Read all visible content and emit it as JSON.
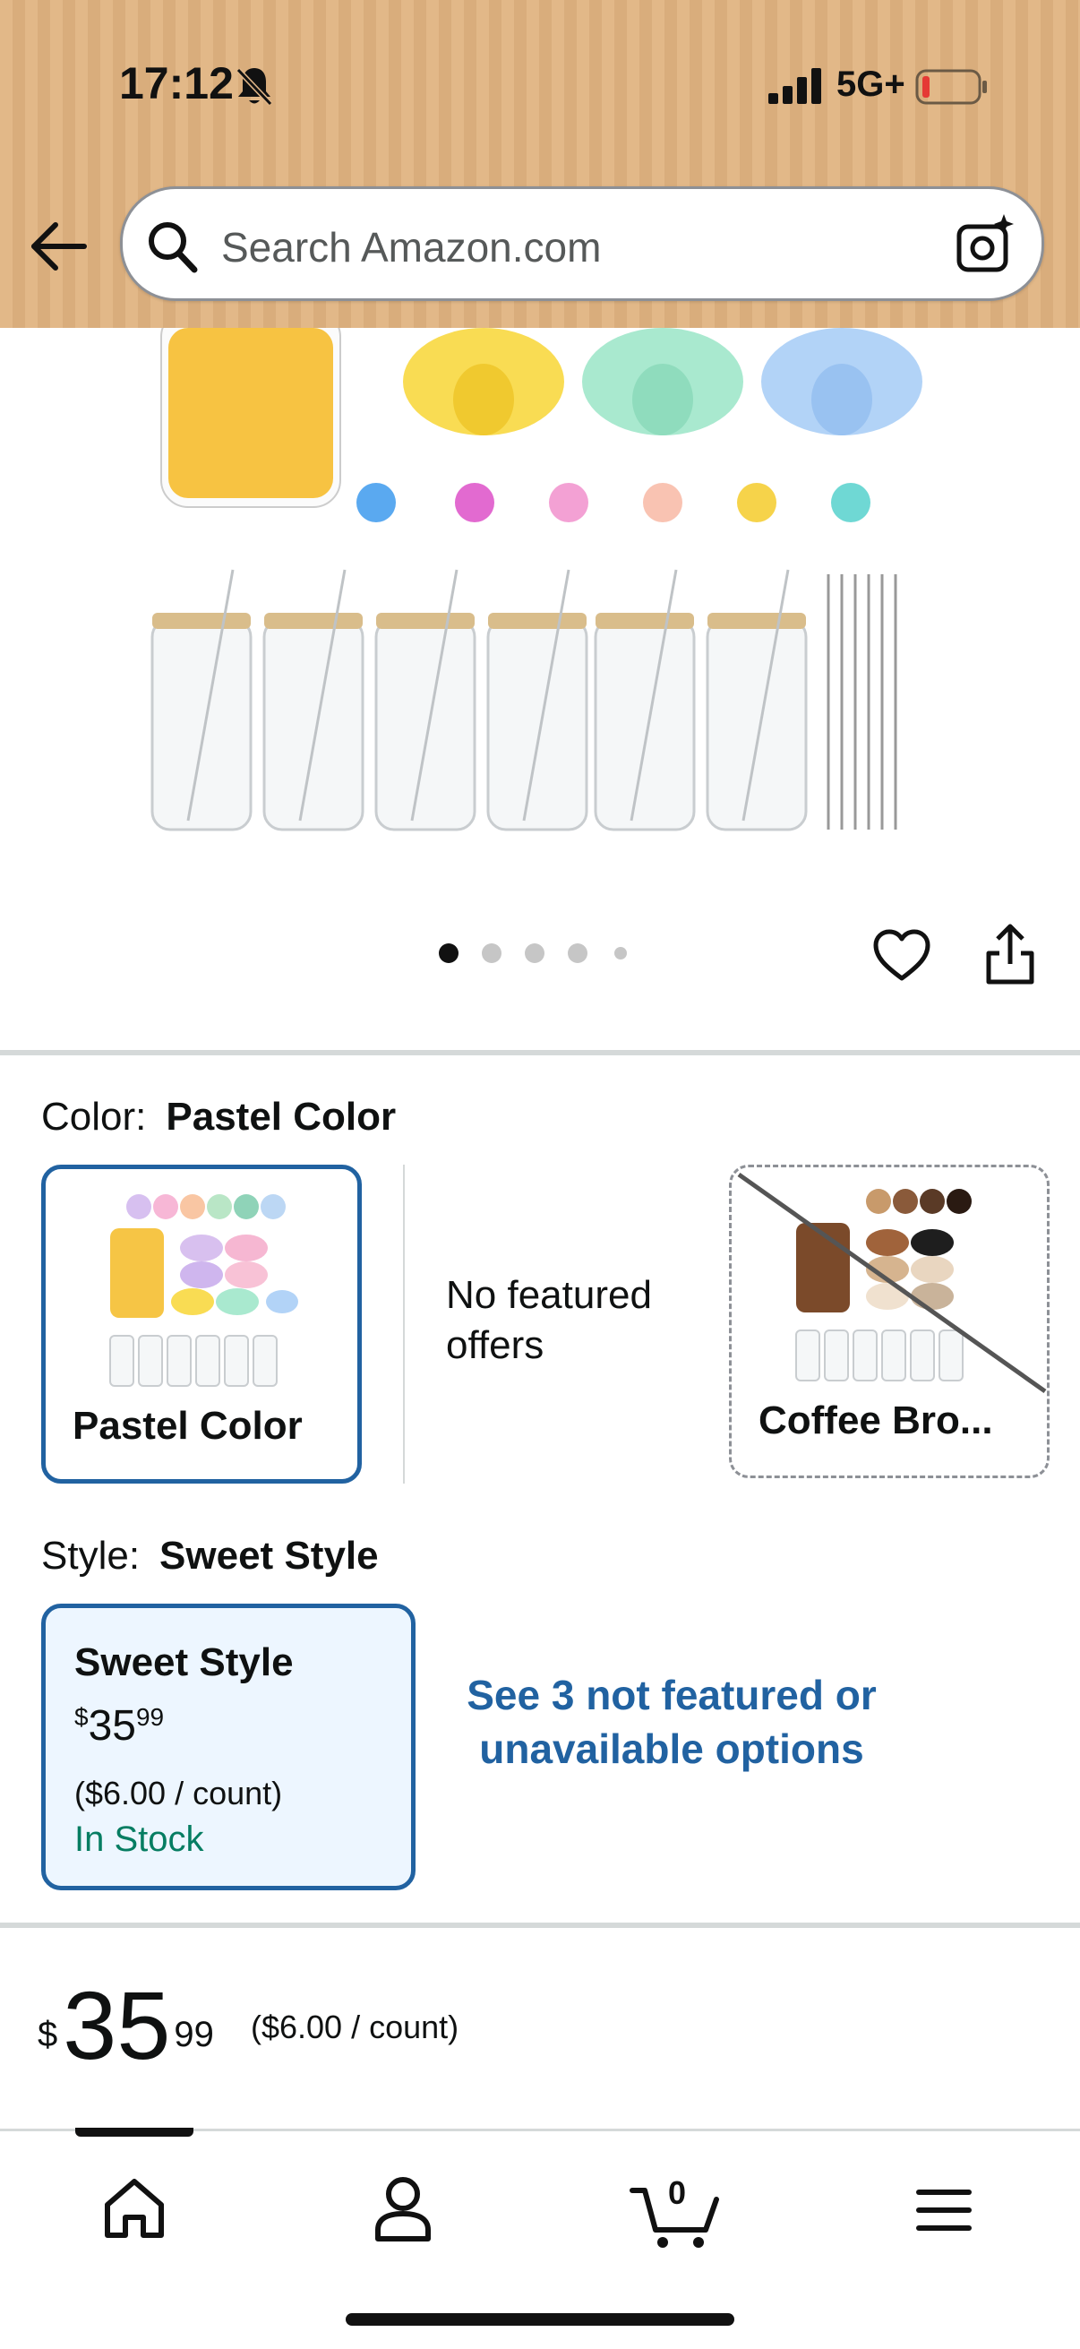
{
  "status_bar": {
    "time": "17:12",
    "network": "5G+",
    "icons": [
      "bell-slash-icon",
      "signal-icon",
      "battery-low-icon"
    ]
  },
  "search": {
    "placeholder": "Search Amazon.com",
    "icons": [
      "back-arrow-icon",
      "search-icon",
      "camera-search-icon"
    ]
  },
  "gallery": {
    "image_count": 5,
    "active_index": 1,
    "icons": [
      "heart-icon",
      "share-icon"
    ]
  },
  "color": {
    "label": "Color:",
    "selected": "Pastel Color",
    "options": [
      {
        "label": "Pastel Color",
        "state": "selected"
      },
      {
        "label": "No featured offers",
        "state": "info"
      },
      {
        "label": "Coffee Bro...",
        "state": "unavailable"
      }
    ],
    "no_offers_text": "No featured offers"
  },
  "style": {
    "label": "Style:",
    "selected": "Sweet Style",
    "card": {
      "name": "Sweet Style",
      "currency": "$",
      "price_whole": "35",
      "price_cents": "99",
      "unit_price": "($6.00 / count)",
      "stock": "In Stock"
    },
    "see_more": "See 3 not featured or unavailable options"
  },
  "price": {
    "currency": "$",
    "whole": "35",
    "cents": "99",
    "unit_price": "($6.00 / count)"
  },
  "bottom_nav": {
    "items": [
      "home-icon",
      "account-icon",
      "cart-icon",
      "menu-icon"
    ],
    "cart_count": "0"
  },
  "colors": {
    "header_bg": "#e2b888",
    "link_blue": "#2162a1",
    "in_stock_green": "#067d62",
    "selected_card_bg": "#edf6ff"
  }
}
